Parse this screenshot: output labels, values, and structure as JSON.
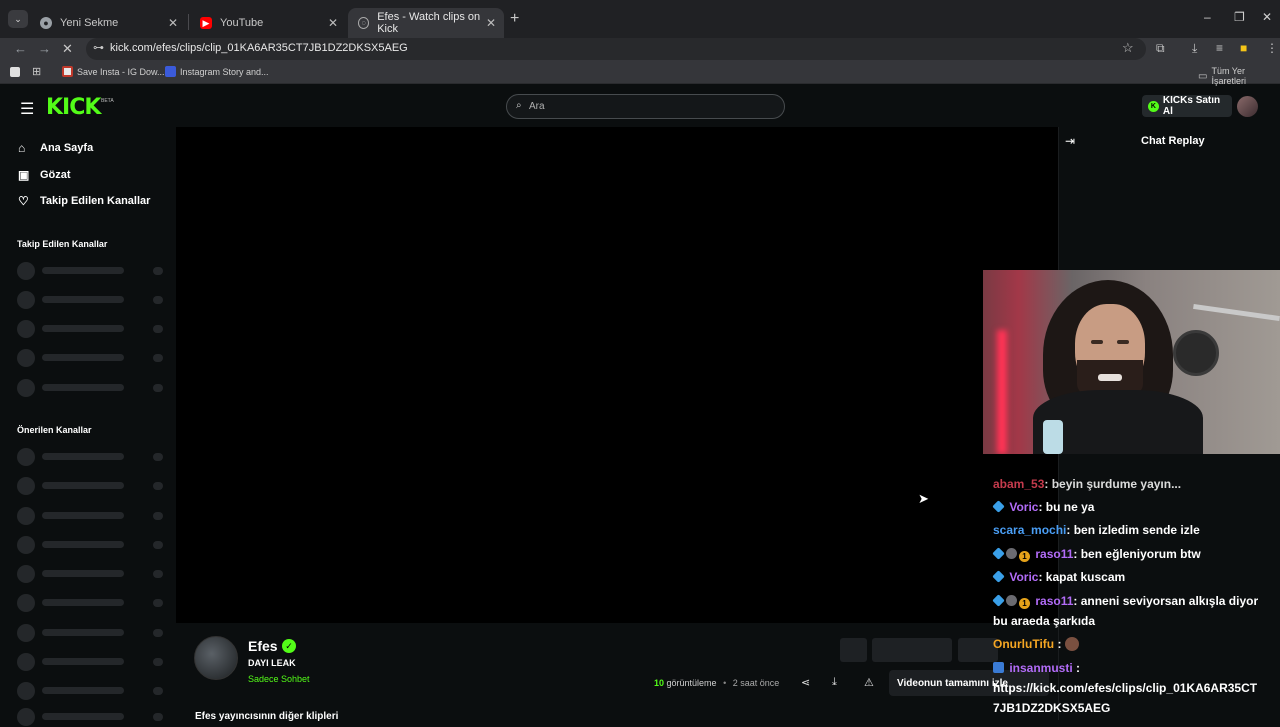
{
  "browser": {
    "tabs": [
      {
        "label": "Yeni Sekme",
        "icon": "chrome-icon"
      },
      {
        "label": "YouTube",
        "icon": "youtube-icon"
      },
      {
        "label": "Efes - Watch clips on Kick",
        "icon": "kick-icon"
      }
    ],
    "url": "kick.com/efes/clips/clip_01KA6AR35CT7JB1DZ2DKSX5AEG",
    "bookmarks": [
      {
        "label": "Save Insta - IG Dow..."
      },
      {
        "label": "Instagram Story and..."
      }
    ],
    "all_bookmarks": "Tüm Yer İşaretleri"
  },
  "header": {
    "logo": "KICK",
    "logo_tag": "BETA",
    "search_placeholder": "Ara",
    "buy_kicks": "KICKs Satın Al"
  },
  "sidebar": {
    "nav": [
      {
        "label": "Ana Sayfa",
        "icon": "home-icon"
      },
      {
        "label": "Gözat",
        "icon": "browse-icon"
      },
      {
        "label": "Takip Edilen Kanallar",
        "icon": "heart-icon"
      }
    ],
    "followed_heading": "Takip Edilen Kanallar",
    "recommended_heading": "Önerilen Kanallar"
  },
  "clip": {
    "channel": "Efes",
    "title": "DAYI LEAK",
    "tag": "Sadece Sohbet",
    "views_count": "10",
    "views_label": "görüntüleme",
    "separator": "•",
    "ago": "2 saat önce",
    "tooltip": "Videonun tamamını izle",
    "more_clips": "Efes yayıncısının diğer klipleri"
  },
  "chat": {
    "title": "Chat Replay",
    "messages": [
      {
        "user": "abam_53",
        "text": ": beyin şurdume yayın..."
      },
      {
        "user": "Voric",
        "text": ": bu ne ya"
      },
      {
        "user": "scara_mochi",
        "text": ": ben izledim sende izle"
      },
      {
        "user": "raso11",
        "text": ": ben eğleniyorum btw"
      },
      {
        "user": "Voric",
        "text": ": kapat kuscam"
      },
      {
        "user": "raso11",
        "text": ": anneni seviyorsan alkışla diyor"
      },
      {
        "user": "",
        "text": "bu araeda şarkıda"
      },
      {
        "user": "OnurluTifu",
        "text": " :"
      },
      {
        "user": "insanmusti",
        "text": " :"
      },
      {
        "user": "",
        "text": "https://kick.com/efes/clips/clip_01KA6AR35CT"
      },
      {
        "user": "",
        "text": "7JB1DZ2DKSX5AEG"
      }
    ]
  },
  "colors": {
    "accent": "#53fc18",
    "bg": "#0b0e0f",
    "user_purple": "#b26cf7",
    "user_blue": "#4a9ef5",
    "user_orange": "#f5a623",
    "user_red": "#e8465b"
  }
}
